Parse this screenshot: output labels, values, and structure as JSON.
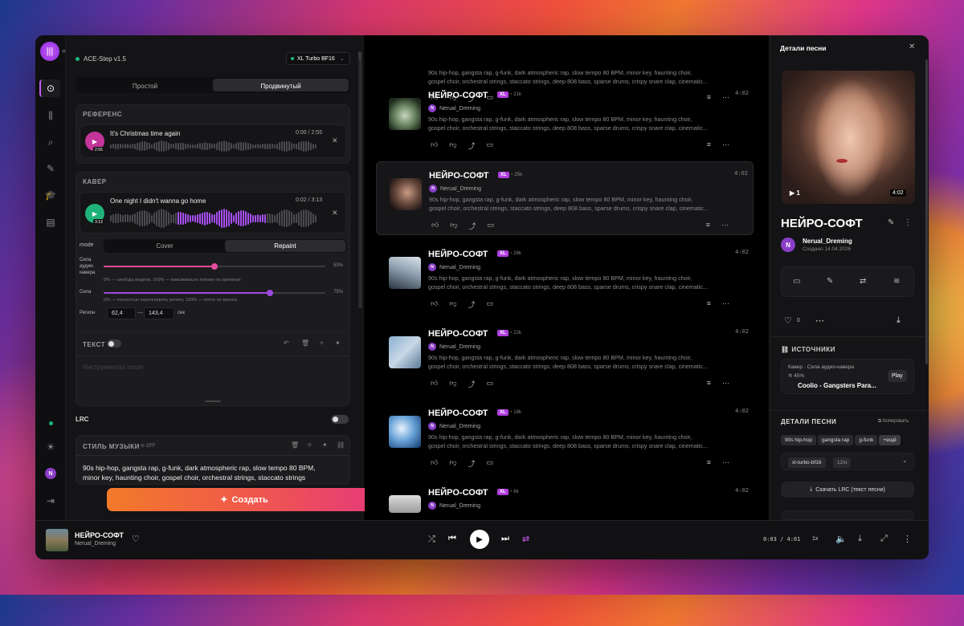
{
  "app": {
    "model_status": "ACE-Step v1.5",
    "model_select": "XL Turbo BF16",
    "collapse": "«"
  },
  "mode_tabs": [
    {
      "label": "Простой"
    },
    {
      "label": "Продвинутый"
    }
  ],
  "reference": {
    "section_label": "РЕФЕРЕНС",
    "track_title": "It's Christmas time again",
    "time": "0:00 / 2:55",
    "thumb_time": "2:55"
  },
  "cover": {
    "section_label": "КАВЕР",
    "track_title": "One night I didn't wanna go home",
    "time": "0:02 / 3:13",
    "thumb_time": "3:13",
    "mode_label": "mode",
    "mode_options": [
      "Cover",
      "Repaint"
    ],
    "mode_selected": "Repaint",
    "strength_label": "Сила аудио-кавера",
    "strength_value": "50%",
    "strength_fraction": 0.5,
    "strength_hint": "0% — свобода модели, 100% — максимально похоже на оригинал",
    "power_label": "Сила",
    "power_value": "75%",
    "power_fraction": 0.75,
    "power_hint": "0% — полностью перегенерить регион, 100% — почти не менять",
    "region_label": "Регион",
    "region_start": "62,4",
    "region_dash": "—",
    "region_end": "143,4",
    "region_unit": "сек"
  },
  "lyrics": {
    "section_label": "ТЕКСТ",
    "placeholder": "Инструментал mode"
  },
  "lrc": {
    "label": "LRC"
  },
  "style": {
    "section_label": "СТИЛЬ МУЗЫКИ",
    "off_label": "OFF",
    "text_line1": "90s hip-hop, gangsta rap, g-funk, dark atmospheric rap, slow tempo 80 BPM,",
    "text_line2": "minor key, haunting choir, gospel choir, orchestral strings, staccato strings"
  },
  "create_button": "Создать",
  "songs": [
    {
      "title": "",
      "author": "",
      "plays": "",
      "duration": "",
      "tags1": "90s hip-hop, gangsta rap, g-funk, dark atmospheric rap, slow tempo 80 BPM, minor key, haunting choir,",
      "tags2": "gospel choir, orchestral strings, staccato strings, deep 808 bass, sparse drums, crispy snare clap, cinematic..."
    },
    {
      "title": "НЕЙРО-СОФТ",
      "author": "Nerual_Dreming",
      "plays": "21k",
      "duration": "4:02",
      "tags1": "90s hip-hop, gangsta rap, g-funk, dark atmospheric rap, slow tempo 80 BPM, minor key, haunting choir,",
      "tags2": "gospel choir, orchestral strings, staccato strings, deep 808 bass, sparse drums, crispy snare clap, cinematic..."
    },
    {
      "title": "НЕЙРО-СОФТ",
      "author": "Nerual_Dreming",
      "plays": "25k",
      "duration": "4:02",
      "tags1": "90s hip-hop, gangsta rap, g-funk, dark atmospheric rap, slow tempo 80 BPM, minor key, haunting choir,",
      "tags2": "gospel choir, orchestral strings, staccato strings, deep 808 bass, sparse drums, crispy snare clap, cinematic..."
    },
    {
      "title": "НЕЙРО-СОФТ",
      "author": "Nerual_Dreming",
      "plays": "26k",
      "duration": "4:02",
      "tags1": "90s hip-hop, gangsta rap, g-funk, dark atmospheric rap, slow tempo 80 BPM, minor key, haunting choir,",
      "tags2": "gospel choir, orchestral strings, staccato strings, deep 808 bass, sparse drums, crispy snare clap, cinematic..."
    },
    {
      "title": "НЕЙРО-СОФТ",
      "author": "Nerual_Dreming",
      "plays": "22k",
      "duration": "4:02",
      "tags1": "90s hip-hop, gangsta rap, g-funk, dark atmospheric rap, slow tempo 80 BPM, minor key, haunting choir,",
      "tags2": "gospel choir, orchestral strings, staccato strings, deep 808 bass, sparse drums, crispy snare clap, cinematic..."
    },
    {
      "title": "НЕЙРО-СОФТ",
      "author": "Nerual_Dreming",
      "plays": "19k",
      "duration": "4:02",
      "tags1": "90s hip-hop, gangsta rap, g-funk, dark atmospheric rap, slow tempo 80 BPM, minor key, haunting choir,",
      "tags2": "gospel choir, orchestral strings, staccato strings, deep 808 bass, sparse drums, crispy snare clap, cinematic..."
    },
    {
      "title": "НЕЙРО-СОФТ",
      "author": "Nerual_Dreming",
      "plays": "6k",
      "duration": "4:02",
      "tags1": "",
      "tags2": ""
    }
  ],
  "details": {
    "header": "Детали песни",
    "play_count": "1",
    "cover_duration": "4:02",
    "title": "НЕЙРО-СОФТ",
    "author": "Nerual_Dreming",
    "created": "Создано 14.04.2026",
    "likes": "0",
    "sources_label": "ИСТОЧНИКИ",
    "source_type": "Кавер · Сила аудио-кавера",
    "source_pct": "45%",
    "source_track": "Coolio - Gangsters Para...",
    "source_play": "Play",
    "details_label": "ДЕТАЛИ ПЕСНИ",
    "copy_label": "Копировать",
    "tags": [
      "90s hip-hop",
      "gangsta rap",
      "g-funk",
      "+ещё"
    ],
    "model_tag": "xl-turbo-bf16",
    "steps_tag": "12st",
    "lrc_button": "Скачать LRC (текст песни)"
  },
  "player": {
    "title": "НЕЙРО-СОФТ",
    "author": "Nerual_Dreming",
    "time": "0:03 / 4:01",
    "speed": "1x",
    "progress_fraction": 0.003
  },
  "colors": {
    "accent": "#c65bf1",
    "create_start": "#f37a2a",
    "create_end": "#e53a7a",
    "green": "#1fb37a"
  }
}
